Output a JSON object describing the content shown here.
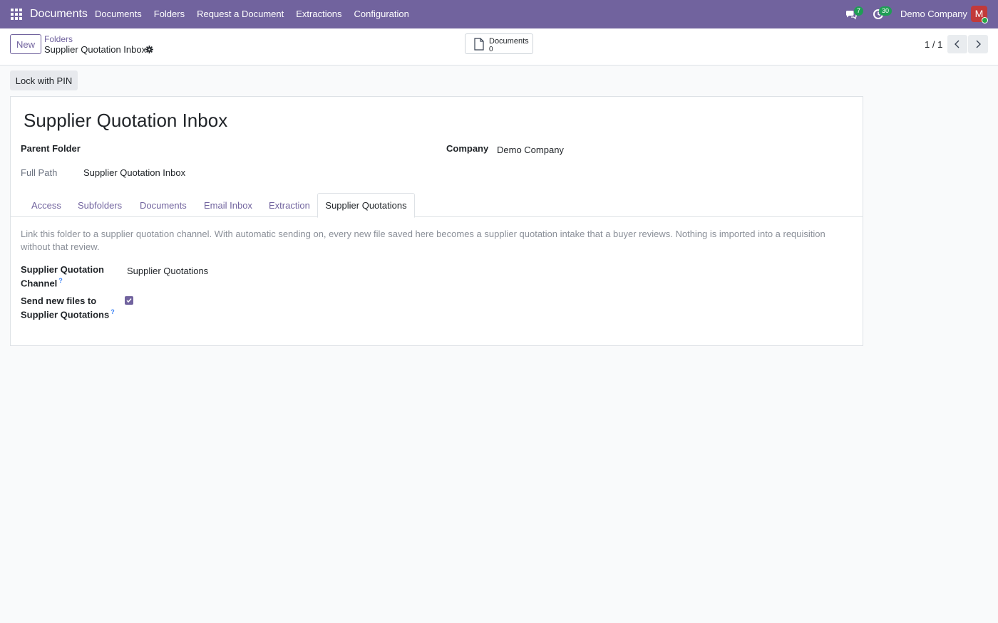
{
  "nav": {
    "brand": "Documents",
    "menu": [
      "Documents",
      "Folders",
      "Request a Document",
      "Extractions",
      "Configuration"
    ],
    "chat_count": "7",
    "activity_count": "30",
    "company": "Demo Company",
    "avatar_initial": "M"
  },
  "control": {
    "new_label": "New",
    "breadcrumb_parent": "Folders",
    "breadcrumb_current": "Supplier Quotation Inbox",
    "smart_button_label": "Documents",
    "smart_button_value": "0",
    "pager": "1 / 1"
  },
  "actions": {
    "lock_label": "Lock with PIN"
  },
  "record": {
    "title": "Supplier Quotation Inbox",
    "parent_folder_label": "Parent Folder",
    "company_label": "Company",
    "company_value": "Demo Company",
    "full_path_label": "Full Path",
    "full_path_value": "Supplier Quotation Inbox"
  },
  "tabs": [
    "Access",
    "Subfolders",
    "Documents",
    "Email Inbox",
    "Extraction",
    "Supplier Quotations"
  ],
  "active_tab": "Supplier Quotations",
  "supplier_tab": {
    "help": "Link this folder to a supplier quotation channel. With automatic sending on, every new file saved here becomes a supplier quotation intake that a buyer reviews. Nothing is imported into a requisition without that review.",
    "channel_label_1": "Supplier Quotation",
    "channel_label_2": "Channel",
    "channel_value": "Supplier Quotations",
    "send_label_1": "Send new files to",
    "send_label_2": "Supplier Quotations",
    "help_marker": "?",
    "send_checked": true
  },
  "colors": {
    "brand": "#71639e",
    "badge": "#1f9d55",
    "avatar": "#c23a3a"
  }
}
